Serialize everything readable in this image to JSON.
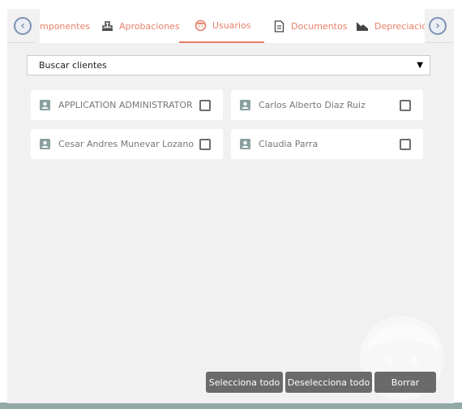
{
  "tabs": [
    {
      "label": "mponentes",
      "icon": "gear-icon",
      "active": false
    },
    {
      "label": "Aprobaciones",
      "icon": "stamp-icon",
      "active": false
    },
    {
      "label": "Usuarios",
      "icon": "user-face-icon",
      "active": true
    },
    {
      "label": "Documentos",
      "icon": "document-icon",
      "active": false
    },
    {
      "label": "Depreciación",
      "icon": "chart-down-icon",
      "active": false
    }
  ],
  "search": {
    "placeholder": "Buscar clientes"
  },
  "users": [
    {
      "name": "APPLICATION ADMINISTRATOR",
      "checked": false
    },
    {
      "name": "Carlos Alberto Diaz Ruiz",
      "checked": false
    },
    {
      "name": "Cesar Andres Munevar Lozano",
      "checked": false
    },
    {
      "name": "Claudia Parra",
      "checked": false
    }
  ],
  "actions": {
    "select_all": "Selecciona todo",
    "deselect_all": "Deselecciona todo",
    "delete": "Borrar"
  },
  "colors": {
    "accent": "#e8806a",
    "nav_arrow": "#7d92b3",
    "button": "#6a6a6a",
    "icon_grey": "#8aa0a0"
  }
}
